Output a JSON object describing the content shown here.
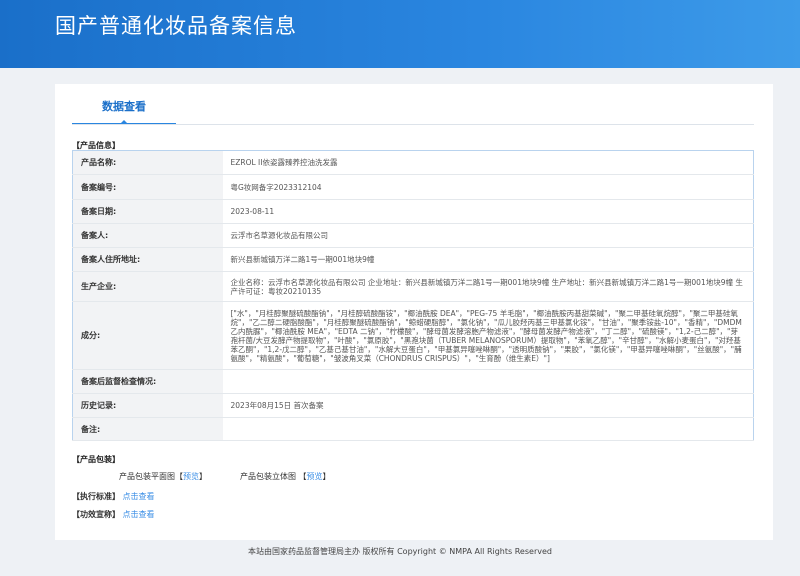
{
  "header": {
    "title": "国产普通化妆品备案信息"
  },
  "tab": {
    "label": "数据查看"
  },
  "product_info": {
    "section": "【产品信息】",
    "rows": [
      {
        "label": "产品名称:",
        "value": "EZROL II依姿露臻养控油洗发露"
      },
      {
        "label": "备案编号:",
        "value": "粤G妆网备字2023312104"
      },
      {
        "label": "备案日期:",
        "value": "2023-08-11"
      },
      {
        "label": "备案人:",
        "value": "云浮市名草源化妆品有限公司"
      },
      {
        "label": "备案人住所地址:",
        "value": "新兴县新城镇万洋二路1号一期001地块9幢"
      },
      {
        "label": "生产企业:",
        "value": "企业名称：云浮市名草源化妆品有限公司 企业地址：新兴县新城镇万洋二路1号一期001地块9幢 生产地址：新兴县新城镇万洋二路1号一期001地块9幢 生产许可证：粤妆20210135"
      },
      {
        "label": "成分:",
        "value": "[\"水\"，\"月桂醇聚醚硫酸酯钠\"，\"月桂醇硫酸酯铵\"，\"椰油酰胺 DEA\"，\"PEG-75 羊毛脂\"，\"椰油酰胺丙基甜菜碱\"，\"聚二甲基硅氧烷醇\"，\"聚二甲基硅氧烷\"，\"乙二醇二硬脂酸酯\"，\"月桂醇聚醚硫酸酯钠\"，\"鲸蜡硬脂醇\"，\"氯化钠\"，\"瓜儿胶羟丙基三甲基氯化铵\"，\"甘油\"，\"聚季铵盐-10\"，\"香精\"，\"DMDM 乙内酰脲\"，\"椰油酰胺 MEA\"，\"EDTA 二钠\"，\"柠檬酸\"，\"酵母菌发酵溶胞产物滤液\"，\"酵母菌发酵产物滤液\"，\"丁二醇\"，\"硫酸镁\"，\"1,2-己二醇\"，\"芽孢杆菌/大豆发酵产物提取物\"，\"叶酸\"，\"氯原胶\"，\"黑孢块菌（TUBER MELANOSPORUM）提取物\"，\"苯氧乙醇\"，\"辛甘醇\"，\"水解小麦蛋白\"，\"对羟基苯乙酮\"，\"1,2-戊二醇\"，\"乙基己基甘油\"，\"水解大豆蛋白\"，\"甲基氯异噻唑啉酮\"，\"透明质酸钠\"，\"果胶\"，\"氯化镁\"，\"甲基异噻唑啉酮\"，\"丝氨酸\"，\"脯氨酸\"，\"精氨酸\"，\"葡萄糖\"，\"皱波角叉菜（CHONDRUS CRISPUS）\"，\"生育酚（维生素E）\"]"
      },
      {
        "label": "备案后监督检查情况:",
        "value": ""
      },
      {
        "label": "历史记录:",
        "value": "2023年08月15日 首次备案"
      },
      {
        "label": "备注:",
        "value": ""
      }
    ]
  },
  "packaging": {
    "section": "【产品包装】",
    "flat_label": "产品包装平面图",
    "flat_link": "预览",
    "solid_label": "产品包装立体图",
    "solid_link": "预览",
    "bracket_open": "【",
    "bracket_close": "】"
  },
  "standard": {
    "section": "【执行标准】",
    "link": "点击查看"
  },
  "efficacy": {
    "section": "【功效宣称】",
    "link": "点击查看"
  },
  "footer": {
    "text": "本站由国家药品监督管理局主办 版权所有 Copyright © NMPA All Rights Reserved"
  }
}
